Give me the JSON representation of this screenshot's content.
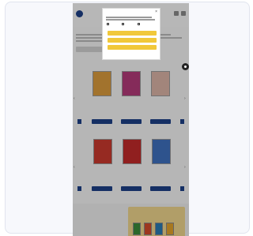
{
  "header": {
    "logo_text": ""
  },
  "notice": {
    "title": ""
  },
  "sections": {
    "first_title": "",
    "second_title": ""
  },
  "row1_books": [
    {
      "cover": "#d99a3c",
      "caption": "",
      "price": ""
    },
    {
      "cover": "#b23a78",
      "caption": "",
      "price": ""
    },
    {
      "cover": "#d9b2a4",
      "caption": "",
      "price": ""
    }
  ],
  "row2_books": [
    {
      "cover": "#c9392e",
      "caption": "",
      "price": ""
    },
    {
      "cover": "#c02a2a",
      "caption": "",
      "price": ""
    },
    {
      "cover": "#3e6fbd",
      "caption": "",
      "price": ""
    }
  ],
  "footer": {
    "title": ""
  },
  "cookie": {
    "title": "",
    "accept_label": "",
    "save_label": "",
    "decline_label": "",
    "link_label": "",
    "footer_text": ""
  },
  "colors": {
    "brand": "#1d3f86",
    "accent": "#f1c83a"
  }
}
